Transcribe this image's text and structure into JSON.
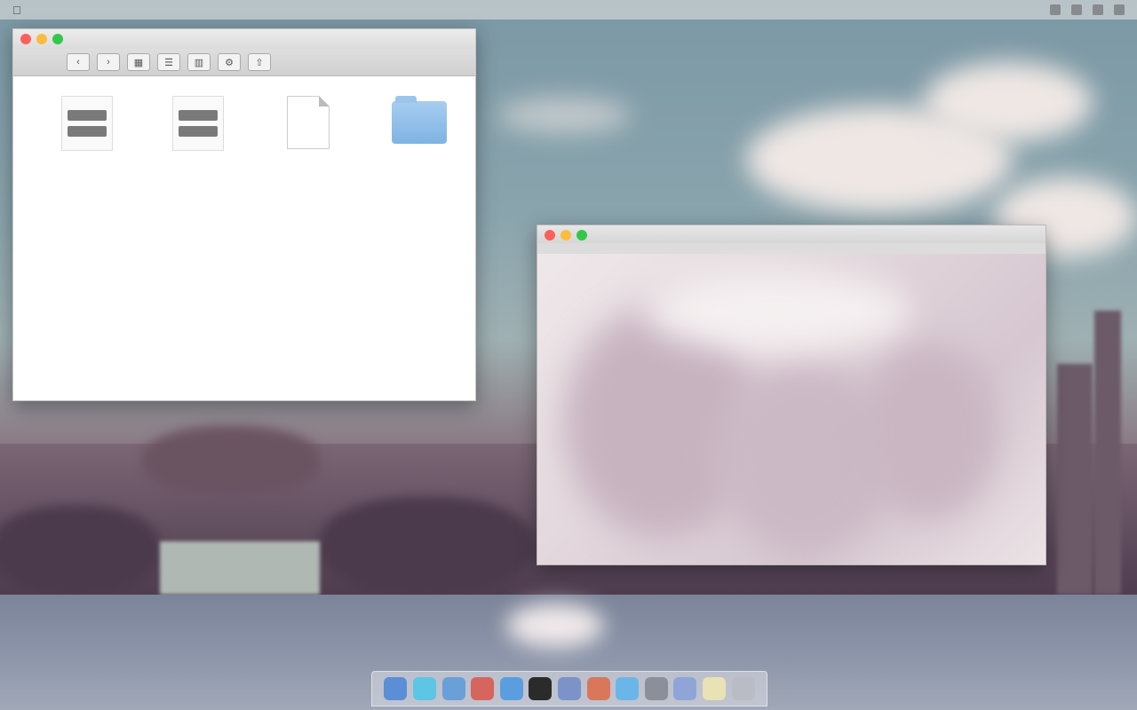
{
  "menubar": {
    "apple_icon": "apple-icon",
    "status_icons": [
      "wifi-icon",
      "battery-icon",
      "clock-icon",
      "search-icon"
    ]
  },
  "finder": {
    "title": "",
    "toolbar": {
      "back_label": "‹",
      "forward_label": "›",
      "buttons": [
        "view-icon-mode",
        "view-list-mode",
        "view-column-mode",
        "arrange",
        "action",
        "share"
      ]
    },
    "items": [
      {
        "label": "",
        "icon": "document-icon"
      },
      {
        "label": "",
        "icon": "document-icon"
      },
      {
        "label": "",
        "icon": "blank-file-icon"
      },
      {
        "label": "",
        "icon": "folder-icon"
      }
    ]
  },
  "viewer": {
    "title": ""
  },
  "dock": {
    "apps": [
      {
        "name": "finder",
        "color": "#5a8fd6"
      },
      {
        "name": "safari",
        "color": "#5cc6e4"
      },
      {
        "name": "mail",
        "color": "#6aa0d8"
      },
      {
        "name": "photos",
        "color": "#d6655e"
      },
      {
        "name": "app-store",
        "color": "#5a9ee0"
      },
      {
        "name": "terminal",
        "color": "#2b2b2b"
      },
      {
        "name": "preview",
        "color": "#7b93c9"
      },
      {
        "name": "calendar",
        "color": "#d9775a"
      },
      {
        "name": "messages",
        "color": "#6bb6e8"
      },
      {
        "name": "system-preferences",
        "color": "#8a8f99"
      },
      {
        "name": "itunes",
        "color": "#8fa5d8"
      },
      {
        "name": "notes",
        "color": "#e8e2b4"
      },
      {
        "name": "trash",
        "color": "#b9bcc4"
      }
    ]
  }
}
